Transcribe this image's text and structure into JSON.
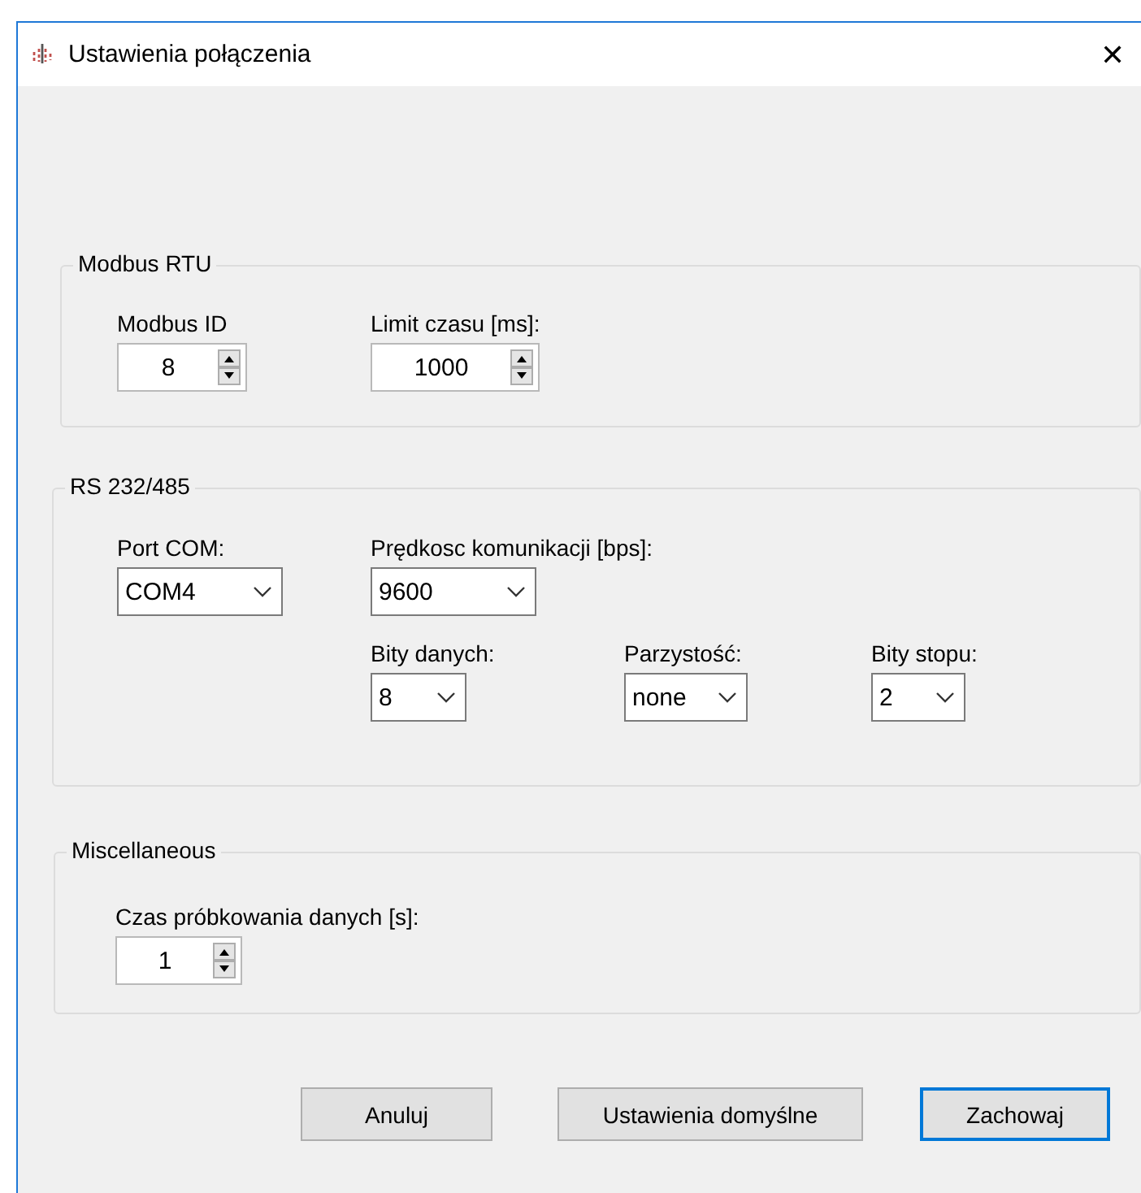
{
  "window": {
    "title": "Ustawienia połączenia",
    "close": "✕"
  },
  "groups": [
    {
      "title": "Modbus RTU",
      "rows": [
        [
          {
            "label": "Modbus ID",
            "kind": "spinner",
            "value": "8"
          },
          {
            "label": "Limit czasu [ms]:",
            "kind": "spinner",
            "value": "1000"
          }
        ]
      ]
    },
    {
      "title": "RS 232/485",
      "rows": [
        [
          {
            "label": "Port COM:",
            "kind": "dropdown",
            "value": "COM4"
          },
          {
            "label": "Prędkosc komunikacji [bps]:",
            "kind": "dropdown",
            "value": "9600"
          }
        ],
        [
          "",
          {
            "label": "Bity danych:",
            "kind": "dropdown",
            "value": "8"
          },
          {
            "label": "Parzystość:",
            "kind": "dropdown",
            "value": "none"
          },
          {
            "label": "Bity stopu:",
            "kind": "dropdown",
            "value": "2"
          }
        ]
      ]
    },
    {
      "title": "Miscellaneous",
      "rows": [
        [
          {
            "label": "Czas próbkowania danych [s]:",
            "kind": "spinner",
            "value": "1"
          }
        ]
      ]
    }
  ],
  "buttons": [
    {
      "label": "Anuluj",
      "default": false
    },
    {
      "label": "Ustawienia domyślne",
      "default": false
    },
    {
      "label": "Zachowaj",
      "default": true
    }
  ]
}
